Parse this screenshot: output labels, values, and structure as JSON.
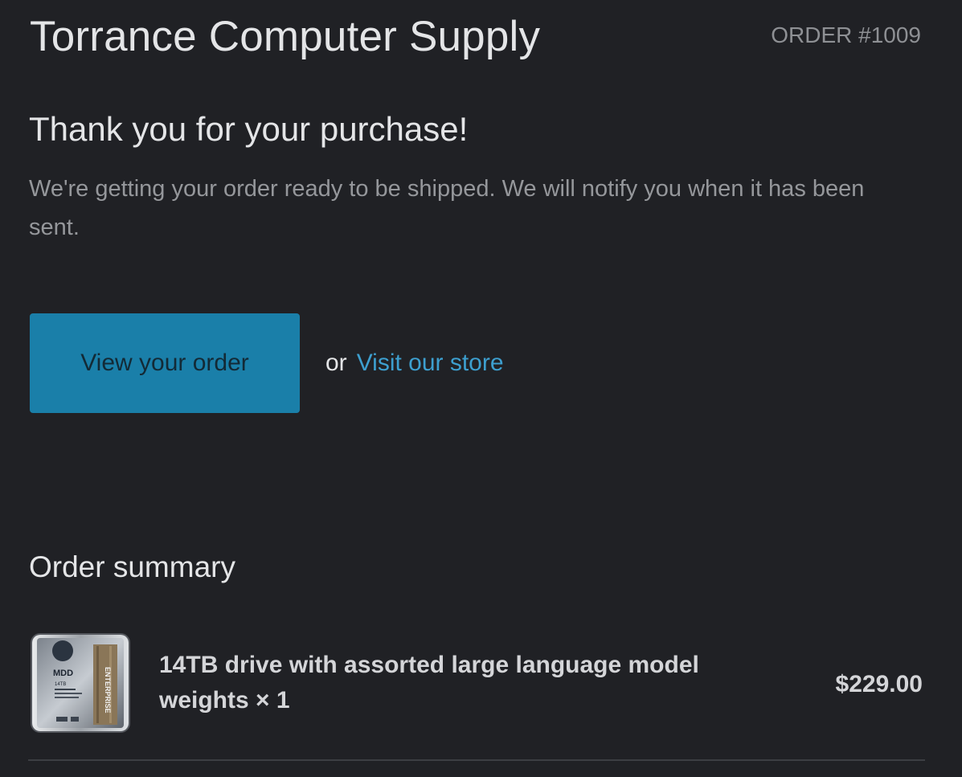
{
  "header": {
    "store_name": "Torrance Computer Supply",
    "order_number": "ORDER #1009"
  },
  "confirmation": {
    "heading": "Thank you for your purchase!",
    "message": "We're getting your order ready to be shipped. We will notify you when it has been sent."
  },
  "actions": {
    "view_order_label": "View your order",
    "or_text": "or",
    "visit_store_label": "Visit our store"
  },
  "summary": {
    "title": "Order summary",
    "items": [
      {
        "name": "14TB drive with assorted large language model weights × 1",
        "price": "$229.00",
        "image_label_brand": "MDD",
        "image_label_series": "ENTERPRISE",
        "image_label_capacity": "14TB"
      }
    ]
  },
  "colors": {
    "background": "#202125",
    "primary_button": "#1a7fa9",
    "link": "#3d9fcf",
    "text_primary": "#e4e5e7",
    "text_secondary": "#95979b"
  }
}
